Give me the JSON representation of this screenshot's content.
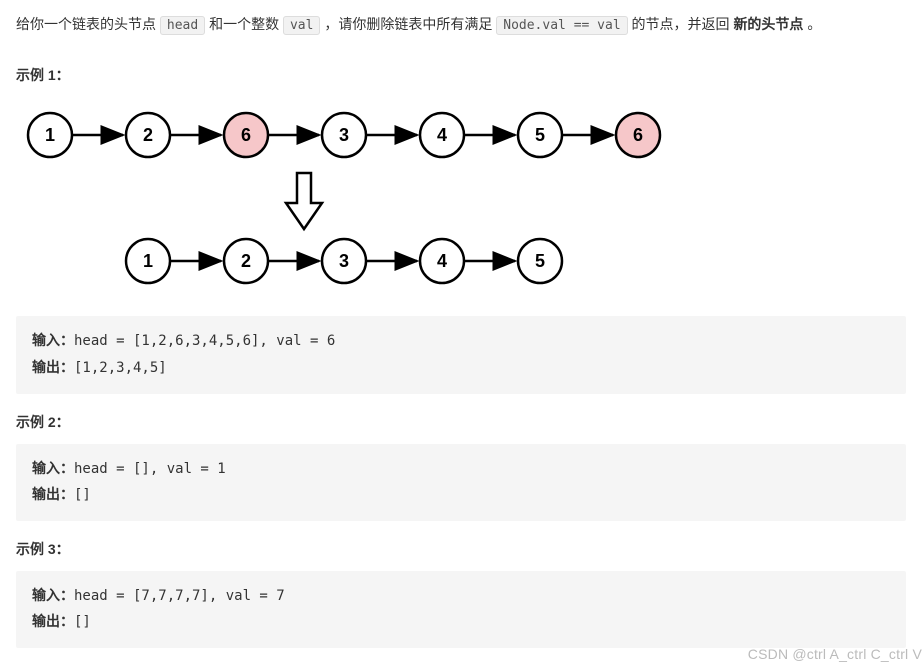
{
  "description": {
    "prefix": "给你一个链表的头节点 ",
    "code1": "head",
    "mid1": " 和一个整数 ",
    "code2": "val",
    "mid2": " ，请你删除链表中所有满足 ",
    "code3": "Node.val == val",
    "mid3": " 的节点，并返回 ",
    "bold1": "新的头节点",
    "suffix": " 。"
  },
  "examples": [
    {
      "label": "示例 1：",
      "input_label": "输入：",
      "input": "head = [1,2,6,3,4,5,6], val = 6",
      "output_label": "输出：",
      "output": "[1,2,3,4,5]"
    },
    {
      "label": "示例 2：",
      "input_label": "输入：",
      "input": "head = [], val = 1",
      "output_label": "输出：",
      "output": "[]"
    },
    {
      "label": "示例 3：",
      "input_label": "输入：",
      "input": "head = [7,7,7,7], val = 7",
      "output_label": "输出：",
      "output": "[]"
    }
  ],
  "chart_data": {
    "type": "diagram",
    "description": "Linked list removal illustration",
    "before": [
      {
        "val": 1,
        "highlight": false
      },
      {
        "val": 2,
        "highlight": false
      },
      {
        "val": 6,
        "highlight": true
      },
      {
        "val": 3,
        "highlight": false
      },
      {
        "val": 4,
        "highlight": false
      },
      {
        "val": 5,
        "highlight": false
      },
      {
        "val": 6,
        "highlight": true
      }
    ],
    "after": [
      {
        "val": 1,
        "highlight": false
      },
      {
        "val": 2,
        "highlight": false
      },
      {
        "val": 3,
        "highlight": false
      },
      {
        "val": 4,
        "highlight": false
      },
      {
        "val": 5,
        "highlight": false
      }
    ],
    "highlight_color": "#f6c7c9",
    "node_fill": "#ffffff",
    "node_stroke": "#000000"
  },
  "watermark": "CSDN @ctrl A_ctrl C_ctrl V"
}
